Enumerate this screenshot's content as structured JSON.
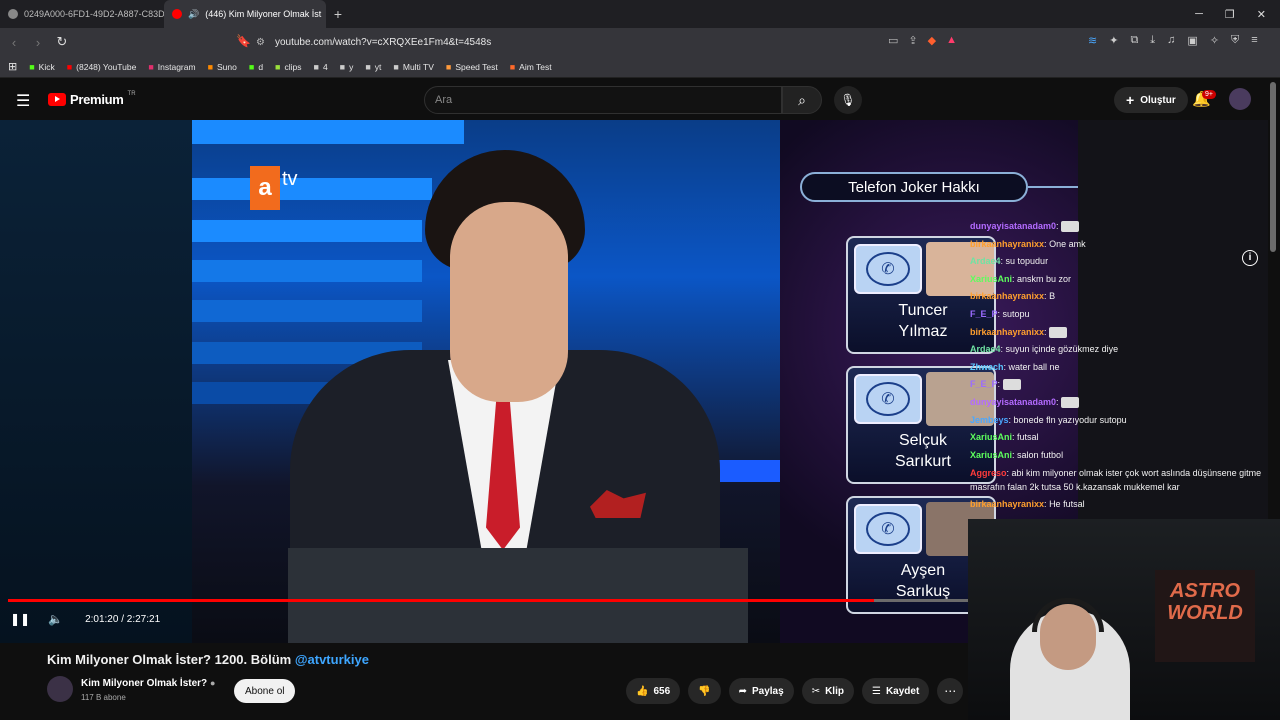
{
  "browser": {
    "tabs": [
      {
        "title": "0249A000-6FD1-49D2-A887-C83D2"
      },
      {
        "title": "(446) Kim Milyoner Olmak İst"
      }
    ],
    "url": "youtube.com/watch?v=cXRQXEe1Fm4&t=4548s",
    "bookmarks": [
      {
        "label": "Kick",
        "icon": "kick-icon",
        "color": "#53fc18"
      },
      {
        "label": "(8248) YouTube",
        "icon": "youtube-icon",
        "color": "#ff0000"
      },
      {
        "label": "Instagram",
        "icon": "instagram-icon",
        "color": "#e1306c"
      },
      {
        "label": "Suno",
        "icon": "suno-icon",
        "color": "#ff8a00"
      },
      {
        "label": "d",
        "icon": "kick-icon",
        "color": "#53fc18"
      },
      {
        "label": "clips",
        "icon": "clips-icon",
        "color": "#9be03c"
      },
      {
        "label": "4",
        "icon": "gear-icon",
        "color": "#cccccc"
      },
      {
        "label": "y",
        "icon": "folder-icon",
        "color": "#cccccc"
      },
      {
        "label": "yt",
        "icon": "folder-icon",
        "color": "#cccccc"
      },
      {
        "label": "Multi TV",
        "icon": "lock-icon",
        "color": "#cccccc"
      },
      {
        "label": "Speed Test",
        "icon": "cloud-icon",
        "color": "#ff9a3c"
      },
      {
        "label": "Aim Test",
        "icon": "target-icon",
        "color": "#ff6a2a"
      }
    ]
  },
  "youtube": {
    "logo_text": "Premium",
    "logo_region": "TR",
    "search_placeholder": "Ara",
    "create_label": "Oluştur",
    "notif_badge": "9+"
  },
  "video": {
    "channel_logo": "a",
    "channel_logo_suffix": "tv",
    "joker_title": "Telefon Joker Hakkı",
    "cards": [
      {
        "name1": "Tuncer",
        "name2": "Yılmaz"
      },
      {
        "name1": "Selçuk",
        "name2": "Sarıkurt"
      },
      {
        "name1": "Ayşen",
        "name2": "Sarıkuş"
      }
    ],
    "poster_text1": "ASTRO",
    "poster_text2": "WORLD",
    "progress_fraction": 0.902,
    "time": "2:01:20 / 2:27:21",
    "chat": [
      {
        "user": "dunyayisatanadam0",
        "msg": "",
        "color": "#b36bff"
      },
      {
        "user": "birkaanhayranixx",
        "msg": "One amk",
        "color": "#ff9f2e"
      },
      {
        "user": "Ardae4",
        "msg": "su topudur",
        "color": "#6fe3a3"
      },
      {
        "user": "XariusAni",
        "msg": "anskm bu zor",
        "color": "#5dff5d"
      },
      {
        "user": "birkaanhayranixx",
        "msg": "B",
        "color": "#ff9f2e"
      },
      {
        "user": "F_E_P",
        "msg": "sutopu",
        "color": "#9b6bff"
      },
      {
        "user": "birkaanhayranixx",
        "msg": "",
        "color": "#ff9f2e"
      },
      {
        "user": "Ardae4",
        "msg": "suyun içinde gözükmez diye",
        "color": "#6fe3a3"
      },
      {
        "user": "Zhwach",
        "msg": "water ball ne",
        "color": "#5ac8ff"
      },
      {
        "user": "F_E_P",
        "msg": "",
        "color": "#9b6bff"
      },
      {
        "user": "dunyayisatanadam0",
        "msg": "",
        "color": "#b36bff"
      },
      {
        "user": "Jembeys",
        "msg": "bonede fln yazıyodur sutopu",
        "color": "#4aa8ff"
      },
      {
        "user": "XariusAni",
        "msg": "futsal",
        "color": "#5dff5d"
      },
      {
        "user": "XariusAni",
        "msg": "salon futbol",
        "color": "#5dff5d"
      },
      {
        "user": "Aggreso",
        "msg": "abi kim milyoner olmak ister çok wort aslında düşünsene gitme masrafın falan 2k tutsa 50 k.kazansak mukkemel kar",
        "color": "#ff3b3b"
      },
      {
        "user": "birkaanhayranixx",
        "msg": "He futsal",
        "color": "#ff9f2e"
      }
    ]
  },
  "below": {
    "title": "Kim Milyoner Olmak İster? 1200. Bölüm",
    "title_tag": "@atvturkiye",
    "channel": "Kim Milyoner Olmak İster?",
    "subs": "117 B abone",
    "subscribe": "Abone ol",
    "likes": "656",
    "share": "Paylaş",
    "clip": "Klip",
    "save": "Kaydet"
  }
}
